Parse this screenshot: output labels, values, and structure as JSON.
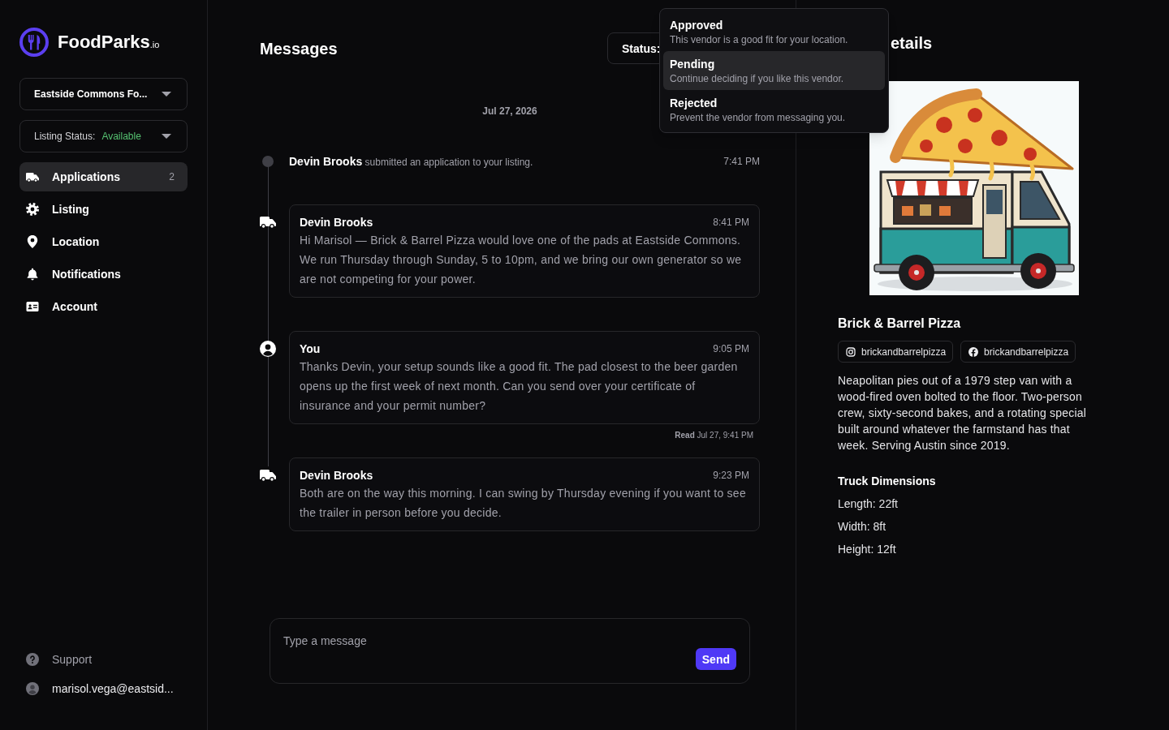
{
  "brand": {
    "name": "FoodParks$_{.io}$"
  },
  "sidebar": {
    "location_select": {
      "value": "Eastside Commons Fo..."
    },
    "listing_status": {
      "label": "Listing Status:",
      "value": "Available"
    },
    "nav": [
      {
        "kind": "truck",
        "label": "Applications",
        "count": "2",
        "selected": true
      },
      {
        "kind": "gear",
        "label": "Listing",
        "selected": false
      },
      {
        "kind": "pin",
        "label": "Location",
        "selected": false
      },
      {
        "kind": "bell",
        "label": "Notifications",
        "selected": false
      },
      {
        "kind": "card",
        "label": "Account",
        "selected": false
      }
    ],
    "footer": [
      {
        "kind": "help",
        "label": "Support"
      },
      {
        "kind": "user",
        "label": "marisol.vega@eastsid..."
      }
    ]
  },
  "messages": {
    "title": "Messages",
    "status_button": {
      "label": "Status:"
    },
    "date": "Jul 27, 2026",
    "timeline": [
      {
        "kind": "event",
        "text": "**Devin Brooks** submitted an application to your listing.",
        "time": "7:41 PM"
      },
      {
        "kind": "vendor",
        "sender": "Devin Brooks",
        "time": "8:41 PM",
        "body": "Hi Marisol — Brick & Barrel Pizza would love one of the pads at Eastside Commons. We run Thursday through Sunday, 5 to 10pm, and we bring our own generator so we are not competing for your power."
      },
      {
        "kind": "own",
        "sender": "You",
        "time": "9:05 PM",
        "body": "Thanks Devin, your setup sounds like a good fit. The pad closest to the beer garden opens up the first week of next month. Can you send over your certificate of insurance and your permit number?",
        "receipt": "**Read** Jul 27, 9:41 PM"
      },
      {
        "kind": "vendor",
        "sender": "Devin Brooks",
        "time": "9:23 PM",
        "body": "Both are on the way this morning. I can swing by Thursday evening if you want to see the trailer in person before you decide."
      }
    ],
    "composer": {
      "placeholder": "Type a message",
      "send_button": "Send"
    }
  },
  "status_menu": {
    "options": [
      {
        "label": "Approved",
        "description": "This vendor is a good fit for your location.",
        "selected": false
      },
      {
        "label": "Pending",
        "description": "Continue deciding if you like this vendor.",
        "selected": true
      },
      {
        "label": "Rejected",
        "description": "Prevent the vendor from messaging you.",
        "selected": false
      }
    ]
  },
  "details": {
    "title": "etails",
    "vendor_name": "Brick & Barrel Pizza",
    "socials": [
      {
        "kind": "instagram",
        "handle": "brickandbarrelpizza"
      },
      {
        "kind": "facebook",
        "handle": "brickandbarrelpizza"
      }
    ],
    "description": "Neapolitan pies out of a 1979 step van with a wood-fired oven bolted to the floor. Two-person crew, sixty-second bakes, and a rotating special built around whatever the farmstand has that week. Serving Austin since 2019.",
    "dimensions": {
      "title": "Truck Dimensions",
      "items": [
        "Length: 22ft",
        "Width: 8ft",
        "Height: 12ft"
      ]
    }
  }
}
